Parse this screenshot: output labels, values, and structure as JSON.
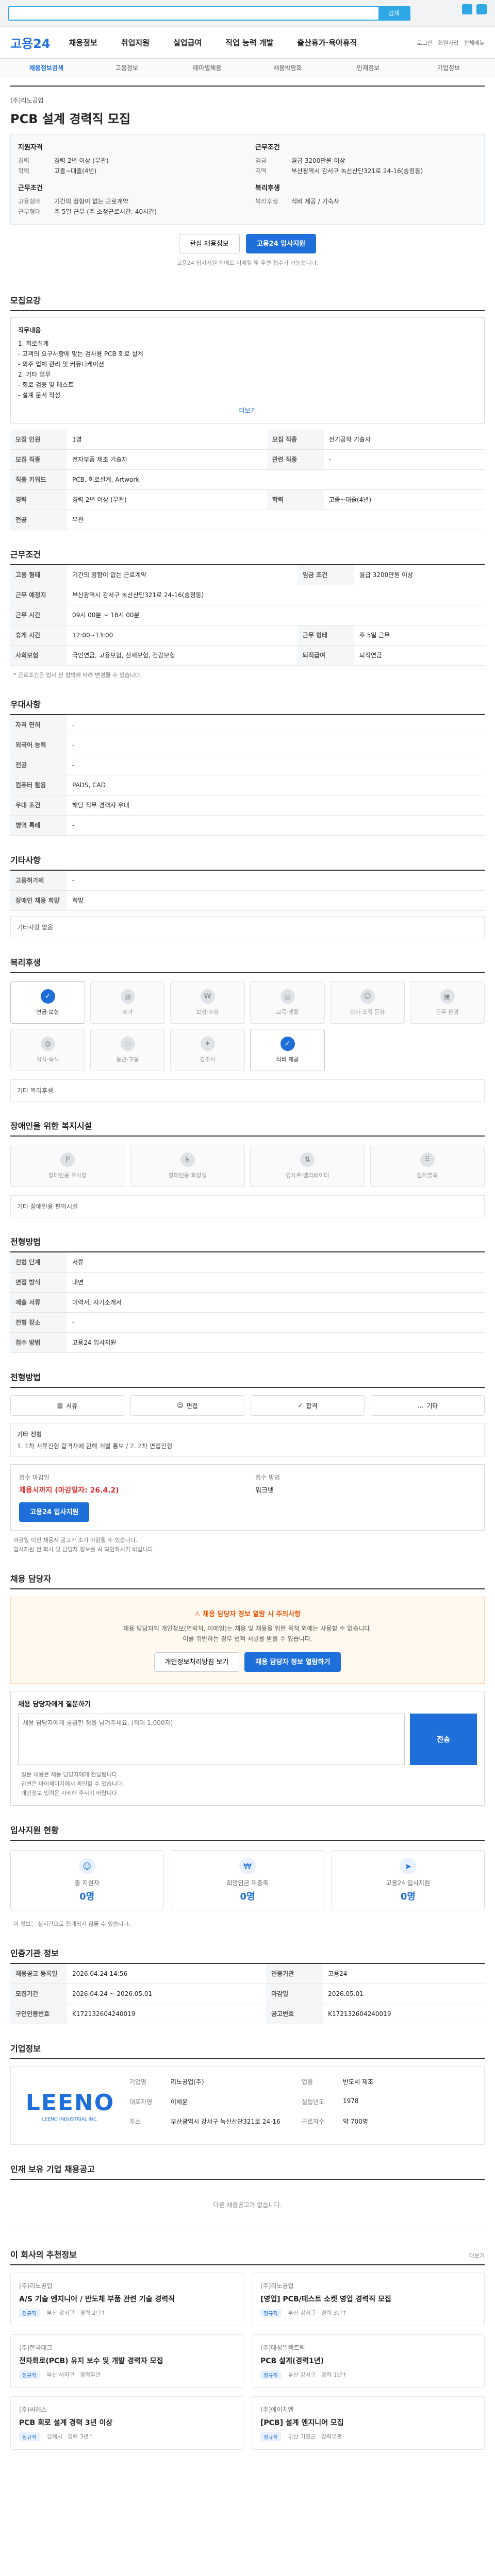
{
  "top": {
    "search_placeholder": "",
    "search_btn": "검색"
  },
  "gnb": {
    "logo": "고용24",
    "menu": [
      "채용정보",
      "취업지원",
      "실업급여",
      "직업 능력 개발",
      "출산휴가·육아휴직"
    ],
    "util": [
      "로그인",
      "회원가입",
      "전체메뉴"
    ]
  },
  "subnav": [
    "채용정보검색",
    "고용정보",
    "테마별채용",
    "채용박람회",
    "인재정보",
    "기업정보"
  ],
  "job": {
    "company": "(주)리노공업",
    "title": "PCB 설계 경력직 모집",
    "recruit_heading": "지원자격",
    "recruit_rows": [
      [
        "경력",
        "경력 2년 이상 (무관)"
      ],
      [
        "학력",
        "고졸~대졸(4년)"
      ]
    ],
    "work_heading": "근무조건",
    "work_rows": [
      [
        "고용형태",
        "기간의 정함이 없는 근로계약"
      ],
      [
        "근무형태",
        "주 5일 근무 (주 소정근로시간: 40시간)"
      ]
    ],
    "salary_heading": "근무조건",
    "salary_rows": [
      [
        "임금",
        "월급 3200만원 이상"
      ],
      [
        "지역",
        "부산광역시 강서구 녹산산단321로 24-16(송정동)"
      ]
    ],
    "pay_heading": "복리후생",
    "pay_rows": [
      [
        "복리후생",
        "식비 제공 / 기숙사"
      ]
    ],
    "btn_interest": "관심 채용정보",
    "btn_apply": "고용24 입사지원",
    "notice": "고용24 입사지원 외에도 이메일 및 우편 접수가 가능합니다."
  },
  "detail": {
    "heading": "모집요강",
    "duty_title": "직무내용",
    "duty_lines": [
      "1. 회로설계",
      "  - 고객의 요구사항에 맞는 검사용 PCB 회로 설계",
      "  - 외주 업체 관리 및 커뮤니케이션",
      "2. 기타 업무",
      "  - 회로 검증 및 테스트",
      "  - 설계 문서 작성"
    ],
    "more": "더보기",
    "rows": [
      [
        "모집 인원",
        "1명",
        "모집 직종",
        "전기공학 기술자"
      ],
      [
        "모집 직종",
        "전자부품 제조 기술자",
        "관련 직종",
        "-"
      ],
      [
        "직종 키워드",
        "PCB, 회로설계, Artwork",
        "",
        ""
      ],
      [
        "경력",
        "경력 2년 이상 (무관)",
        "학력",
        "고졸~대졸(4년)"
      ],
      [
        "전공",
        "무관",
        "",
        ""
      ]
    ]
  },
  "condition": {
    "heading": "근무조건",
    "rows": [
      [
        "고용 형태",
        "기간의 정함이 없는 근로계약",
        "임금 조건",
        "월급 3200만원 이상"
      ],
      [
        "근무 예정지",
        "부산광역시 강서구 녹산산단321로 24-16(송정동)",
        "",
        ""
      ],
      [
        "근무 시간",
        "09시 00분 ~ 18시 00분",
        "",
        ""
      ],
      [
        "휴게 시간",
        "12:00~13:00",
        "근무 형태",
        "주 5일 근무"
      ],
      [
        "사회보험",
        "국민연금, 고용보험, 산재보험, 건강보험",
        "퇴직급여",
        "퇴직연금"
      ]
    ],
    "note": "* 근로조건은 입사 전 협의에 따라 변경될 수 있습니다."
  },
  "qual": {
    "heading": "우대사항",
    "rows": [
      [
        "자격 면허",
        "-"
      ],
      [
        "외국어 능력",
        "-"
      ],
      [
        "전공",
        "-"
      ],
      [
        "컴퓨터 활용",
        "PADS, CAD"
      ],
      [
        "우대 조건",
        "해당 직무 경력자 우대"
      ],
      [
        "병역 특례",
        "-"
      ]
    ]
  },
  "extra": {
    "heading": "기타사항",
    "rows": [
      [
        "고용허가제",
        "-"
      ],
      [
        "장애인 채용 희망",
        "희망"
      ]
    ],
    "box": "기타사항 없음"
  },
  "welfare": {
    "heading": "복리후생",
    "items": [
      {
        "label": "연금·보험",
        "on": true
      },
      {
        "label": "휴가",
        "on": false
      },
      {
        "label": "보상·수당",
        "on": false
      },
      {
        "label": "교육·생활",
        "on": false
      },
      {
        "label": "회사·조직 문화",
        "on": false
      },
      {
        "label": "근무 환경",
        "on": false
      },
      {
        "label": "식사·숙식",
        "on": false
      },
      {
        "label": "통근·교통",
        "on": false
      },
      {
        "label": "경조사",
        "on": false
      },
      {
        "label": "식비 제공",
        "on": true
      }
    ],
    "other": "기타 복리후생"
  },
  "disability": {
    "heading": "장애인을 위한 복지시설",
    "items": [
      "장애인용 주차장",
      "장애인용 화장실",
      "경사로·엘리베이터",
      "점자블록"
    ],
    "other": "기타 장애인용 편의시설"
  },
  "screening": {
    "heading": "전형방법",
    "rows": [
      [
        "전형 단계",
        "서류"
      ],
      [
        "면접 방식",
        "대면"
      ],
      [
        "제출 서류",
        "이력서, 자기소개서"
      ],
      [
        "전형 장소",
        "-"
      ],
      [
        "접수 방법",
        "고용24 입사지원"
      ]
    ]
  },
  "process": {
    "heading": "전형방법",
    "steps": [
      "서류",
      "면접",
      "합격",
      "기타"
    ],
    "text_title": "기타 전형",
    "text": "1. 1차 서류전형 합격자에 한해 개별 통보 / 2. 2차 면접전형",
    "deadline_label": "접수 마감일",
    "deadline": "채용시까지 (마감일자: 26.4.2)",
    "method_label": "접수 방법",
    "method": "워크넷",
    "apply_btn": "고용24 입사지원",
    "warnings": [
      "마감일 이전 채용시 공고가 조기 마감될 수 있습니다.",
      "입사지원 전 회사 및 담당자 정보를 꼭 확인하시기 바랍니다."
    ]
  },
  "contact": {
    "heading": "채용 담당자",
    "notice_title": "채용 담당자 정보 열람 시 주의사항",
    "notice_lines": [
      "채용 담당자의 개인정보(연락처, 이메일)는 채용 및 채용을 위한 목적 외에는 사용할 수 없습니다.",
      "이를 위반하는 경우 법적 처벌을 받을 수 있습니다."
    ],
    "btn_personal": "개인정보처리방침 보기",
    "btn_view": "채용 담당자 정보 열람하기",
    "q_title": "채용 담당자에게 질문하기",
    "q_placeholder": "채용 담당자에게 궁금한 점을 남겨주세요. (최대 1,000자)",
    "q_send": "전송",
    "bullets": [
      "질문 내용은 채용 담당자에게 전달됩니다.",
      "답변은 마이페이지에서 확인할 수 있습니다.",
      "개인정보 입력은 자제해 주시기 바랍니다."
    ]
  },
  "stats": {
    "heading": "입사지원 현황",
    "items": [
      {
        "label": "총 지원자",
        "value": "0명"
      },
      {
        "label": "희망임금 미충족",
        "value": "0명"
      },
      {
        "label": "고용24 입사지원",
        "value": "0명"
      }
    ],
    "note": "이 정보는 실시간으로 집계되지 않을 수 있습니다."
  },
  "info": {
    "heading": "인증기관 정보",
    "rows": [
      [
        "채용공고 등록일",
        "2026.04.24 14:56",
        "인증기관",
        "고용24"
      ],
      [
        "모집기간",
        "2026.04.24 ~ 2026.05.01",
        "마감일",
        "2026.05.01"
      ],
      [
        "구인인증번호",
        "K172132604240019",
        "공고번호",
        "K172132604240019"
      ]
    ]
  },
  "company": {
    "heading": "기업정보",
    "logo": "LEENO",
    "logo_sub": "LEENO INDUSTRIAL INC.",
    "meta": [
      [
        "기업명",
        "리노공업(주)"
      ],
      [
        "업종",
        "반도체 제조"
      ],
      [
        "대표자명",
        "이채윤"
      ],
      [
        "설립년도",
        "1978"
      ],
      [
        "주소",
        "부산광역시 강서구 녹산산단321로 24-16"
      ],
      [
        "근로자수",
        "약 700명"
      ]
    ]
  },
  "other_jobs": {
    "heading": "인재 보유 기업 채용공고",
    "empty": "다른 채용공고가 없습니다."
  },
  "recommend": {
    "heading": "이 회사의 추천정보",
    "more": "더보기",
    "items": [
      {
        "company": "(주)리노공업",
        "title": "A/S 기술 엔지니어 / 반도체 부품 관련 기술 경력직",
        "tag": "정규직",
        "meta": [
          "부산 강서구",
          "경력 2년↑"
        ]
      },
      {
        "company": "(주)리노공업",
        "title": "[영업] PCB/테스트 소켓 영업 경력직 모집",
        "tag": "정규직",
        "meta": [
          "부산 강서구",
          "경력 3년↑"
        ]
      },
      {
        "company": "(주)한국테크",
        "title": "전자회로(PCB) 유지 보수 및 개발 경력자 모집",
        "tag": "정규직",
        "meta": [
          "부산 사하구",
          "경력무관"
        ]
      },
      {
        "company": "(주)대성일렉트릭",
        "title": "PCB 설계(경력1년)",
        "tag": "정규직",
        "meta": [
          "부산 강서구",
          "경력 1년↑"
        ]
      },
      {
        "company": "(주)씨에스",
        "title": "PCB 회로 설계 경력 3년 이상",
        "tag": "정규직",
        "meta": [
          "김해시",
          "경력 3년↑"
        ]
      },
      {
        "company": "(주)에이치엔",
        "title": "[PCB] 설계 엔지니어 모집",
        "tag": "정규직",
        "meta": [
          "부산 기장군",
          "경력무관"
        ]
      }
    ]
  }
}
